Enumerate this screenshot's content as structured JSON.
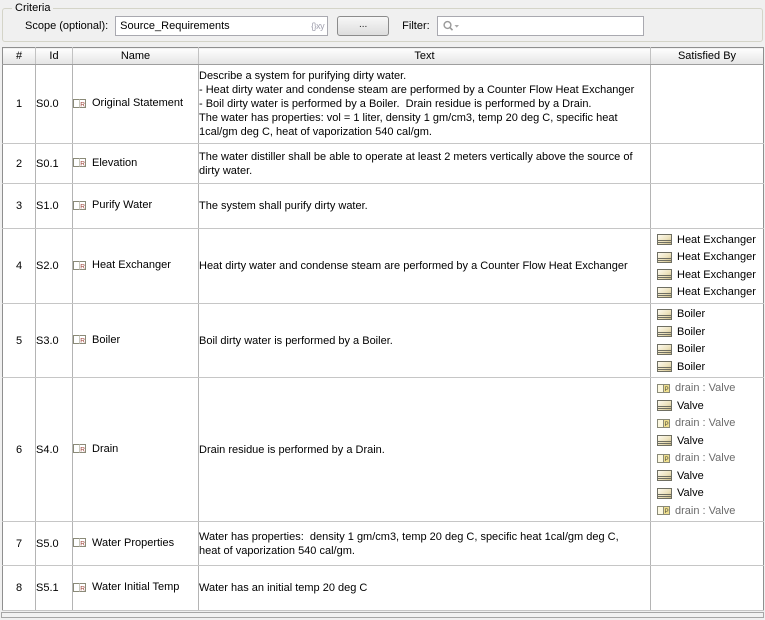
{
  "criteria": {
    "title": "Criteria",
    "scope_label": "Scope (optional):",
    "scope_value": "Source_Requirements",
    "scope_icon": "{}xy",
    "browse_label": "...",
    "filter_label": "Filter:",
    "filter_value": ""
  },
  "colors": {
    "block_icon_fill": "#C9B983",
    "part_icon_fill": "#EFDF8E",
    "requirement_letter": "#993A2E",
    "grid_line": "#B4B4B4",
    "header_gradient_bottom": "#E4E4E4"
  },
  "table": {
    "columns": [
      "#",
      "Id",
      "Name",
      "Text",
      "Satisfied By"
    ],
    "rows": [
      {
        "num": "1",
        "id": "S0.0",
        "name": "Original Statement",
        "text": "Describe a system for purifying dirty water.\n- Heat dirty water and condense steam are performed by a Counter Flow Heat Exchanger\n- Boil dirty water is performed by a Boiler.  Drain residue is performed by a Drain.\nThe water has properties: vol = 1 liter, density 1 gm/cm3, temp 20 deg C, specific heat\n1cal/gm deg C, heat of vaporization 540 cal/gm.",
        "satisfied": []
      },
      {
        "num": "2",
        "id": "S0.1",
        "name": "Elevation",
        "text": "The water distiller shall be able to operate at least 2 meters vertically above the source of\ndirty water.",
        "satisfied": []
      },
      {
        "num": "3",
        "id": "S1.0",
        "name": "Purify Water",
        "text": "The system shall purify dirty water.",
        "satisfied": []
      },
      {
        "num": "4",
        "id": "S2.0",
        "name": "Heat Exchanger",
        "text": "Heat dirty water and condense steam are performed by a Counter Flow Heat Exchanger",
        "satisfied": [
          {
            "icon": "block",
            "label": "Heat Exchanger"
          },
          {
            "icon": "block",
            "label": "Heat Exchanger"
          },
          {
            "icon": "block",
            "label": "Heat Exchanger"
          },
          {
            "icon": "block",
            "label": "Heat Exchanger"
          }
        ]
      },
      {
        "num": "5",
        "id": "S3.0",
        "name": "Boiler",
        "text": "Boil dirty water is performed by a Boiler.",
        "satisfied": [
          {
            "icon": "block",
            "label": "Boiler"
          },
          {
            "icon": "block",
            "label": "Boiler"
          },
          {
            "icon": "block",
            "label": "Boiler"
          },
          {
            "icon": "block",
            "label": "Boiler"
          }
        ]
      },
      {
        "num": "6",
        "id": "S4.0",
        "name": "Drain",
        "text": "Drain residue is performed by a Drain.",
        "satisfied": [
          {
            "icon": "part",
            "label": "drain : Valve"
          },
          {
            "icon": "block",
            "label": "Valve"
          },
          {
            "icon": "part",
            "label": "drain : Valve"
          },
          {
            "icon": "block",
            "label": "Valve"
          },
          {
            "icon": "part",
            "label": "drain : Valve"
          },
          {
            "icon": "block",
            "label": "Valve"
          },
          {
            "icon": "block",
            "label": "Valve"
          },
          {
            "icon": "part",
            "label": "drain : Valve"
          }
        ]
      },
      {
        "num": "7",
        "id": "S5.0",
        "name": "Water Properties",
        "text": "Water has properties:  density 1 gm/cm3, temp 20 deg C, specific heat 1cal/gm deg C,\nheat of vaporization 540 cal/gm.",
        "satisfied": []
      },
      {
        "num": "8",
        "id": "S5.1",
        "name": "Water Initial Temp",
        "text": "Water has an initial temp 20 deg C",
        "satisfied": []
      }
    ]
  }
}
